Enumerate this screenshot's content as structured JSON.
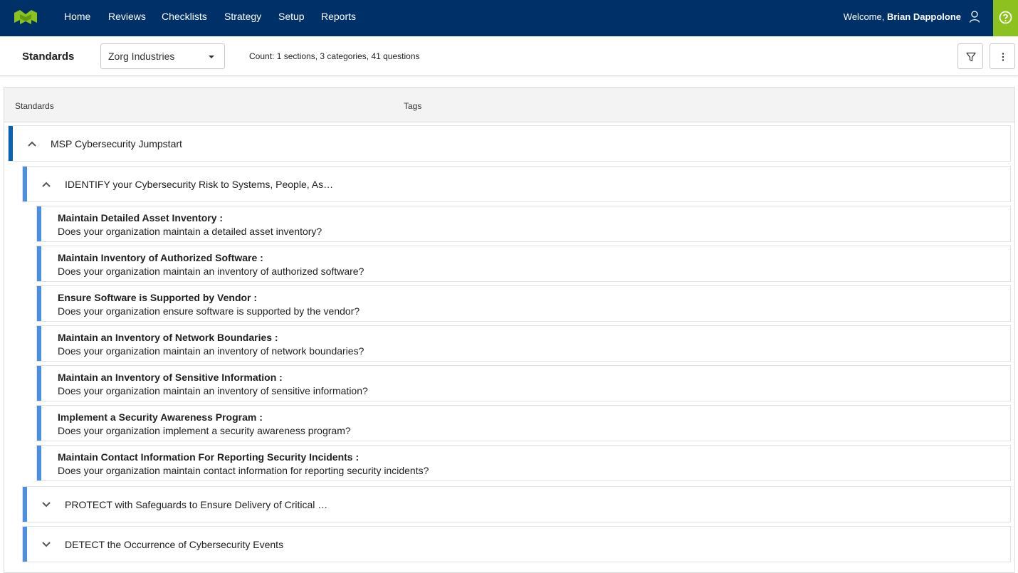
{
  "topnav": {
    "logo_icon": "company-logo",
    "items": [
      {
        "label": "Home"
      },
      {
        "label": "Reviews"
      },
      {
        "label": "Checklists"
      },
      {
        "label": "Strategy"
      },
      {
        "label": "Setup"
      },
      {
        "label": "Reports"
      }
    ],
    "welcome_prefix": "Welcome,",
    "user_name": "Brian Dappolone",
    "user_icon": "user-icon",
    "help_icon": "help-icon",
    "colors": {
      "nav_bg": "#003068",
      "help_bg": "#8cc11f"
    }
  },
  "toolbar": {
    "title": "Standards",
    "client_select": {
      "value": "Zorg Industries"
    },
    "count_prefix": "Count:",
    "count_value": "1 sections, 3 categories, 41 questions",
    "filter_icon": "filter-icon",
    "more_icon": "more-vertical-icon"
  },
  "table": {
    "headers": {
      "standards": "Standards",
      "tags": "Tags"
    },
    "section": {
      "label": "MSP Cybersecurity Jumpstart",
      "expanded": true
    },
    "categories": [
      {
        "label": "IDENTIFY your Cybersecurity Risk to Systems, People, As…",
        "expanded": true
      },
      {
        "label": "PROTECT with Safeguards to Ensure Delivery of Critical …",
        "expanded": false
      },
      {
        "label": "DETECT the Occurrence of Cybersecurity Events",
        "expanded": false
      }
    ],
    "questions": [
      {
        "title": "Maintain Detailed Asset Inventory :",
        "text": "Does your organization maintain a detailed asset inventory?"
      },
      {
        "title": "Maintain Inventory of Authorized Software :",
        "text": "Does your organization maintain an inventory of authorized software?"
      },
      {
        "title": "Ensure Software is Supported by Vendor :",
        "text": "Does your organization ensure software is supported by the vendor?"
      },
      {
        "title": "Maintain an Inventory of Network Boundaries :",
        "text": "Does your organization maintain an inventory of network boundaries?"
      },
      {
        "title": "Maintain an Inventory of Sensitive Information :",
        "text": "Does your organization maintain an inventory of sensitive information?"
      },
      {
        "title": "Implement a Security Awareness Program :",
        "text": "Does your organization implement a security awareness program?"
      },
      {
        "title": "Maintain Contact Information For Reporting Security Incidents :",
        "text": "Does your organization maintain contact information for reporting security incidents?"
      }
    ],
    "colors": {
      "section_bar": "#0b62b0",
      "category_bar": "#4b8fe0"
    }
  }
}
